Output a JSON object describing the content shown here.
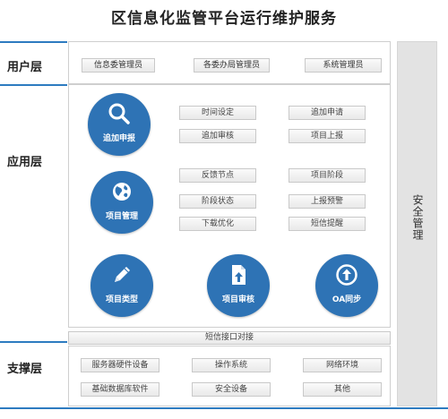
{
  "title": "区信息化监管平台运行维护服务",
  "layers": {
    "user": "用户层",
    "app": "应用层",
    "support": "支撑层"
  },
  "security": "安全管理",
  "user_roles": [
    "信息委管理员",
    "各委办局管理员",
    "系统管理员"
  ],
  "modules": [
    {
      "label": "追加申报",
      "icon": "search-icon"
    },
    {
      "label": "项目管理",
      "icon": "globe-icon"
    },
    {
      "label": "项目类型",
      "icon": "pencil-icon"
    },
    {
      "label": "项目审核",
      "icon": "document-upload-icon"
    },
    {
      "label": "OA同步",
      "icon": "upload-circle-icon"
    }
  ],
  "functions_top": [
    "时间设定",
    "追加申请",
    "追加审核",
    "项目上报"
  ],
  "functions_mid": [
    "反馈节点",
    "项目阶段",
    "阶段状态",
    "上报预警",
    "下载优化",
    "短信提醒"
  ],
  "sms_interface": "短信接口对接",
  "support_items": [
    "服务器硬件设备",
    "操作系统",
    "网络环境",
    "基础数据库软件",
    "安全设备",
    "其他"
  ],
  "colors": {
    "accent": "#2d7bc0",
    "circle": "#2e73b5",
    "side_panel": "#e3e3e3"
  }
}
